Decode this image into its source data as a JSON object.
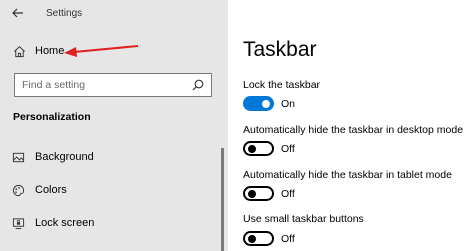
{
  "window": {
    "title": "Settings"
  },
  "sidebar": {
    "home_label": "Home",
    "search_placeholder": "Find a setting",
    "section_heading": "Personalization",
    "items": [
      {
        "label": "Background",
        "icon": "image-icon"
      },
      {
        "label": "Colors",
        "icon": "palette-icon"
      },
      {
        "label": "Lock screen",
        "icon": "lock-screen-icon"
      }
    ]
  },
  "annotation": {
    "arrow_color": "#e02020"
  },
  "main": {
    "title": "Taskbar",
    "accent_color": "#0078d7",
    "settings": [
      {
        "label": "Lock the taskbar",
        "state": "On",
        "on": true
      },
      {
        "label": "Automatically hide the taskbar in desktop mode",
        "state": "Off",
        "on": false
      },
      {
        "label": "Automatically hide the taskbar in tablet mode",
        "state": "Off",
        "on": false
      },
      {
        "label": "Use small taskbar buttons",
        "state": "Off",
        "on": false
      }
    ]
  }
}
